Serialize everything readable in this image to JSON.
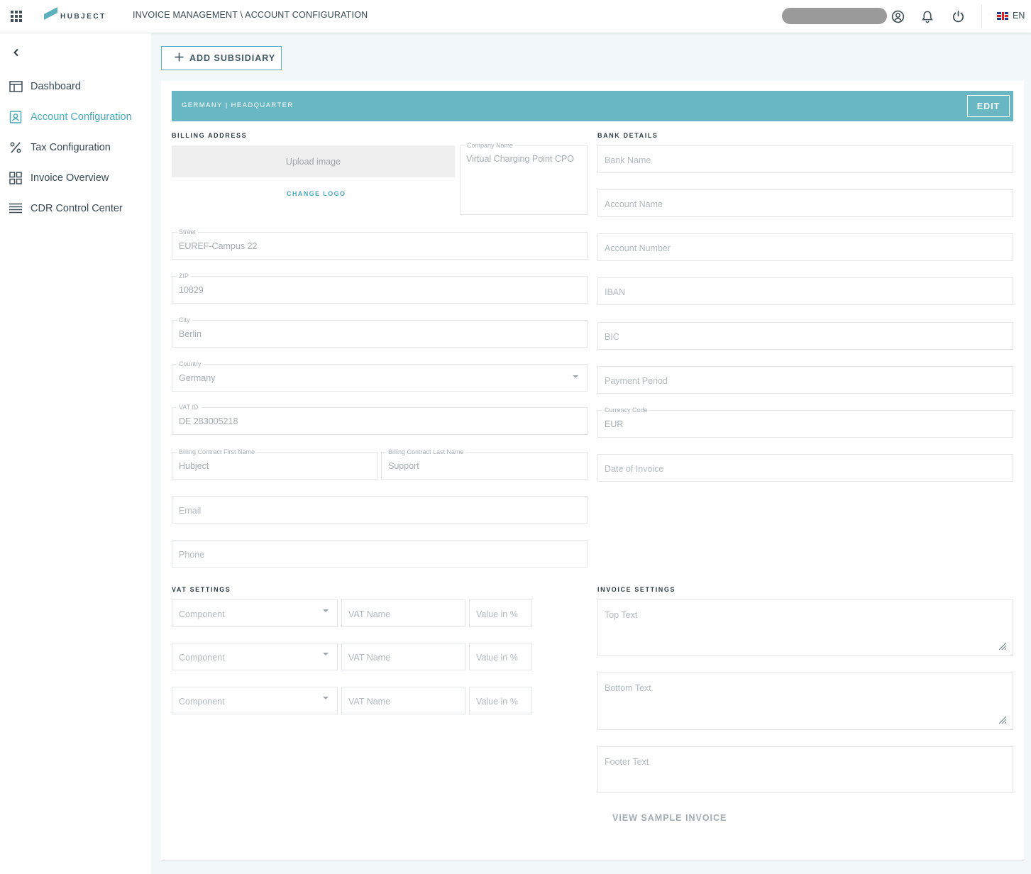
{
  "header": {
    "logo_text": "HUBJECT",
    "breadcrumb": "INVOICE MANAGEMENT \\ ACCOUNT CONFIGURATION",
    "language": "EN"
  },
  "sidebar": {
    "items": [
      {
        "label": "Dashboard",
        "icon": "dashboard-icon"
      },
      {
        "label": "Account Configuration",
        "icon": "account-config-icon",
        "active": true
      },
      {
        "label": "Tax Configuration",
        "icon": "percent-icon"
      },
      {
        "label": "Invoice Overview",
        "icon": "grid-icon"
      },
      {
        "label": "CDR Control Center",
        "icon": "list-icon"
      }
    ]
  },
  "main": {
    "add_subsidiary_label": "ADD SUBSIDIARY",
    "card_title": "GERMANY | HEADQUARTER",
    "edit_label": "EDIT",
    "billing": {
      "section_title": "BILLING ADDRESS",
      "upload_label": "Upload image",
      "change_logo_label": "CHANGE LOGO",
      "company_name_label": "Company Name",
      "company_name_value": "Virtual Charging Point CPO",
      "street_label": "Street",
      "street_value": "EUREF-Campus 22",
      "zip_label": "ZIP",
      "zip_value": "10829",
      "city_label": "City",
      "city_value": "Berlin",
      "country_label": "Country",
      "country_value": "Germany",
      "vat_id_label": "VAT ID",
      "vat_id_value": "DE 283005218",
      "first_name_label": "Billing Contract First Name",
      "first_name_value": "Hubject",
      "last_name_label": "Billing Contract Last Name",
      "last_name_value": "Support",
      "email_placeholder": "Email",
      "phone_placeholder": "Phone"
    },
    "bank": {
      "section_title": "BANK DETAILS",
      "bank_name_placeholder": "Bank Name",
      "account_name_placeholder": "Account Name",
      "account_number_placeholder": "Account Number",
      "iban_placeholder": "IBAN",
      "bic_placeholder": "BIC",
      "payment_period_placeholder": "Payment Period",
      "currency_code_label": "Currency Code",
      "currency_code_value": "EUR",
      "date_of_invoice_placeholder": "Date of Invoice"
    },
    "vat_settings": {
      "section_title": "VAT SETTINGS",
      "rows": [
        {
          "component": "Component",
          "vat_name": "VAT Name",
          "value": "Value in %"
        },
        {
          "component": "Component",
          "vat_name": "VAT Name",
          "value": "Value in %"
        },
        {
          "component": "Component",
          "vat_name": "VAT Name",
          "value": "Value in %"
        }
      ]
    },
    "invoice_settings": {
      "section_title": "INVOICE SETTINGS",
      "top_text_placeholder": "Top Text",
      "bottom_text_placeholder": "Bottom Text",
      "footer_text_placeholder": "Footer Text",
      "view_sample_label": "VIEW SAMPLE INVOICE"
    }
  },
  "colors": {
    "accent": "#4aa8b8",
    "header_bar": "#6ab7c4",
    "background": "#f2f7f8"
  }
}
